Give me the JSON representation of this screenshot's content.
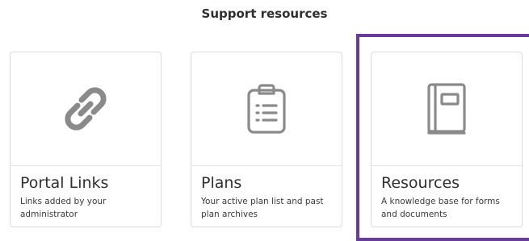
{
  "section": {
    "title": "Support resources"
  },
  "cards": [
    {
      "title": "Portal Links",
      "description": "Links added by your administrator",
      "icon": "link-icon"
    },
    {
      "title": "Plans",
      "description": "Your active plan list and past plan archives",
      "icon": "clipboard-list-icon"
    },
    {
      "title": "Resources",
      "description": "A knowledge base for forms and documents",
      "icon": "book-icon"
    }
  ],
  "colors": {
    "icon": "#8a8a8a",
    "highlight": "#6a3c9a",
    "card_border": "#dcdcdc"
  }
}
